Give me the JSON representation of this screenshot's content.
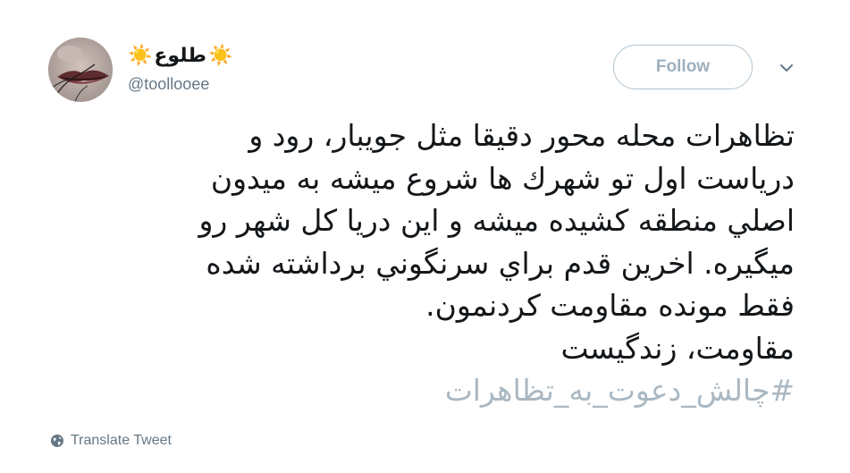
{
  "tweet": {
    "display_name": "طلوع",
    "sun_emoji": "☀️",
    "handle": "@toollooee",
    "follow_label": "Follow",
    "text_lines": [
      "تظاهرات محله محور دقيقا مثل جويبار، رود و",
      "درياست اول تو شهرك ها شروع ميشه به ميدون",
      "اصلي منطقه كشيده ميشه و اين دريا كل شهر رو",
      "ميگيره. اخرين قدم براي سرنگوني برداشته شده",
      "فقط مونده مقاومت كردنمون.",
      "مقاومت، زندگيست"
    ],
    "hashtag": "#چالش_دعوت_به_تظاهرات",
    "translate_label": "Translate Tweet"
  },
  "icons": {
    "caret": "chevron-down-icon",
    "globe": "globe-icon"
  },
  "colors": {
    "text": "#14171a",
    "muted": "#657786",
    "hashtag": "#aab8c2",
    "follow_border": "#b3c3cf",
    "follow_text": "#9eb0bd"
  }
}
